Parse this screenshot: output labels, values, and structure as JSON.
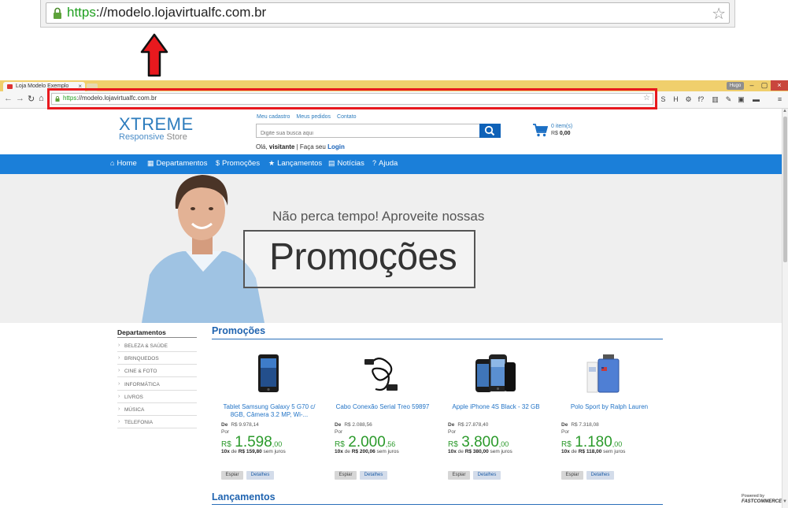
{
  "zoom_bar": {
    "url_https": "https",
    "url_rest": "://modelo.lojavirtualfc.com.br"
  },
  "browser": {
    "tab_title": "Loja Modelo Exemplo",
    "user": "Hugo",
    "url_https": "https",
    "url_rest": "://modelo.lojavirtualfc.com.br",
    "extensions": [
      "S",
      "H",
      "⚙",
      "f?",
      "▥",
      "✎",
      "▣",
      "▬",
      "≡"
    ]
  },
  "header": {
    "logo_line1": "XTREME",
    "logo_responsive": "Responsive",
    "logo_store": "Store",
    "links": [
      "Meu cadastro",
      "Meus pedidos",
      "Contato"
    ],
    "search_placeholder": "Digite sua busca aqui",
    "greeting_prefix": "Olá,",
    "greeting_user": "visitante",
    "greeting_sep": "| Faça seu",
    "login_label": "Login",
    "cart_count": "0 item(s)",
    "cart_currency": "R$",
    "cart_total": "0,00"
  },
  "nav": [
    {
      "icon": "⌂",
      "label": "Home"
    },
    {
      "icon": "▦",
      "label": "Departamentos"
    },
    {
      "icon": "$",
      "label": "Promoções"
    },
    {
      "icon": "★",
      "label": "Lançamentos"
    },
    {
      "icon": "▤",
      "label": "Notícias"
    },
    {
      "icon": "?",
      "label": "Ajuda"
    }
  ],
  "banner": {
    "subtitle": "Não perca tempo! Aproveite nossas",
    "title": "Promoções"
  },
  "departments": {
    "title": "Departamentos",
    "items": [
      "BELEZA & SAÚDE",
      "BRINQUEDOS",
      "CINE & FOTO",
      "INFORMÁTICA",
      "LIVROS",
      "MÚSICA",
      "TELEFONIA"
    ]
  },
  "sections": {
    "promo_title": "Promoções",
    "launch_title": "Lançamentos"
  },
  "products": [
    {
      "name": "Tablet Samsung Galaxy 5 G70 c/ 8GB, Câmera 3.2 MP, Wi-...",
      "de_label": "De",
      "old_price": "R$ 9.978,14",
      "por_label": "Por",
      "currency": "R$",
      "price_int": "1.598",
      "price_cents": ",00",
      "inst_prefix": "10x",
      "inst_de": "de",
      "inst_value": "R$ 159,80",
      "inst_suffix": "sem juros",
      "btn_espiar": "Espiar",
      "btn_detalhes": "Detalhes",
      "image": "tablet"
    },
    {
      "name": "Cabo Conexão Serial Treo 59897",
      "de_label": "De",
      "old_price": "R$ 2.088,56",
      "por_label": "Por",
      "currency": "R$",
      "price_int": "2.000",
      "price_cents": ",56",
      "inst_prefix": "10x",
      "inst_de": "de",
      "inst_value": "R$ 200,06",
      "inst_suffix": "sem juros",
      "btn_espiar": "Espiar",
      "btn_detalhes": "Detalhes",
      "image": "cable"
    },
    {
      "name": "Apple iPhone 4S Black - 32 GB",
      "de_label": "De",
      "old_price": "R$ 27.878,40",
      "por_label": "Por",
      "currency": "R$",
      "price_int": "3.800",
      "price_cents": ",00",
      "inst_prefix": "10x",
      "inst_de": "de",
      "inst_value": "R$ 380,00",
      "inst_suffix": "sem juros",
      "btn_espiar": "Espiar",
      "btn_detalhes": "Detalhes",
      "image": "iphone"
    },
    {
      "name": "Polo Sport by Ralph Lauren",
      "de_label": "De",
      "old_price": "R$ 7.318,08",
      "por_label": "Por",
      "currency": "R$",
      "price_int": "1.180",
      "price_cents": ",00",
      "inst_prefix": "10x",
      "inst_de": "de",
      "inst_value": "R$ 118,00",
      "inst_suffix": "sem juros",
      "btn_espiar": "Espiar",
      "btn_detalhes": "Detalhes",
      "image": "perfume"
    }
  ],
  "footer": {
    "powered_by": "Powered by",
    "brand": "FASTCOMMERCE"
  },
  "colors": {
    "brand_blue": "#1b7fd9",
    "price_green": "#2b9a2b",
    "highlight_red": "#e8191e",
    "tab_strip": "#f0cf6c"
  }
}
